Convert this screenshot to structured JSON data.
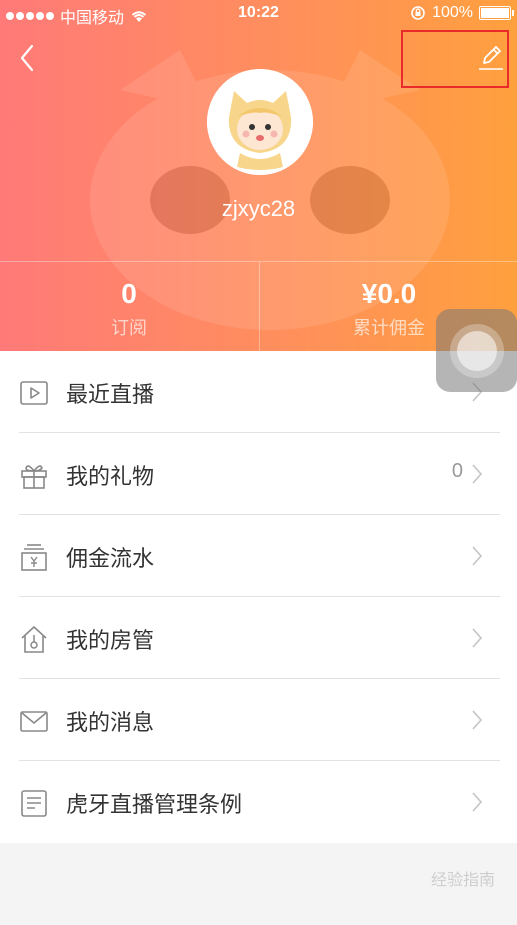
{
  "status_bar": {
    "carrier": "中国移动",
    "time": "10:22",
    "battery": "100%",
    "battery_level": 1.0
  },
  "profile": {
    "username": "zjxyc28"
  },
  "stats": [
    {
      "value": "0",
      "label": "订阅"
    },
    {
      "value": "¥0.0",
      "label": "累计佣金"
    }
  ],
  "menu": [
    {
      "label": "最近直播",
      "icon": "play-icon",
      "count": ""
    },
    {
      "label": "我的礼物",
      "icon": "gift-icon",
      "count": "0"
    },
    {
      "label": "佣金流水",
      "icon": "commission-icon",
      "count": ""
    },
    {
      "label": "我的房管",
      "icon": "house-manager-icon",
      "count": ""
    },
    {
      "label": "我的消息",
      "icon": "mail-icon",
      "count": ""
    },
    {
      "label": "虎牙直播管理条例",
      "icon": "document-icon",
      "count": ""
    }
  ],
  "watermark": "经验指南",
  "colors": {
    "header_start": "#ff7a78",
    "header_end": "#ffa03e",
    "highlight_box": "#e82a2a"
  }
}
